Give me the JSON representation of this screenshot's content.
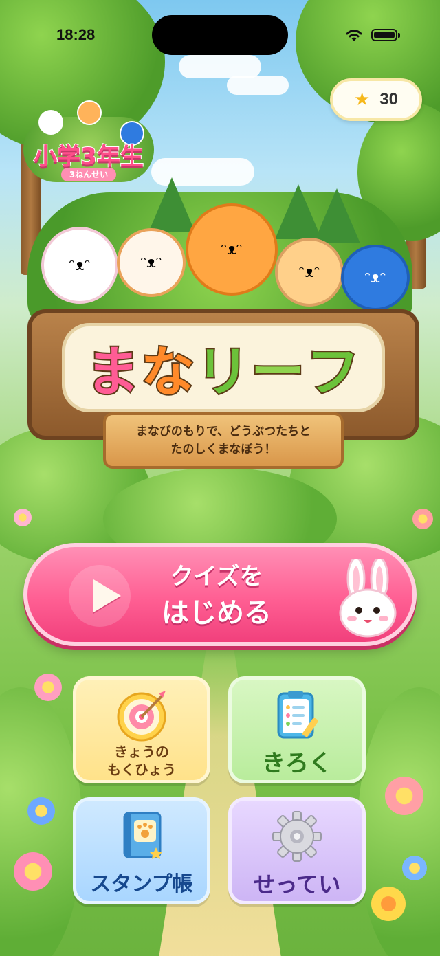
{
  "status_bar": {
    "time": "18:28"
  },
  "stars": {
    "icon": "star-icon",
    "count": "30"
  },
  "grade_badge": {
    "label": "小学3年生",
    "reading": "3ねんせい"
  },
  "logo": {
    "title_chars": [
      "ま",
      "な",
      "リ",
      "ー",
      "フ"
    ],
    "title_colors": [
      "#ff5c95",
      "#ff8a2a",
      "#6cc23a",
      "#8fd34e",
      "#6cc23a"
    ]
  },
  "tagline": {
    "line1": "まなびのもりで、どうぶつたちと",
    "line2": "たのしくまなぼう！"
  },
  "start_button": {
    "line1": "クイズを",
    "line2": "はじめる",
    "icon": "play-icon"
  },
  "menu": {
    "goal": {
      "label_line1": "きょうの",
      "label_line2": "もくひょう",
      "icon": "target-icon",
      "color": "#ffe28a"
    },
    "record": {
      "label": "きろく",
      "icon": "clipboard-icon",
      "color": "#b9ec9c"
    },
    "stamp": {
      "label": "スタンプ帳",
      "icon": "stamp-book-icon",
      "color": "#a9d6ff"
    },
    "settings": {
      "label": "せってい",
      "icon": "gear-icon",
      "color": "#cdb5f5"
    }
  }
}
